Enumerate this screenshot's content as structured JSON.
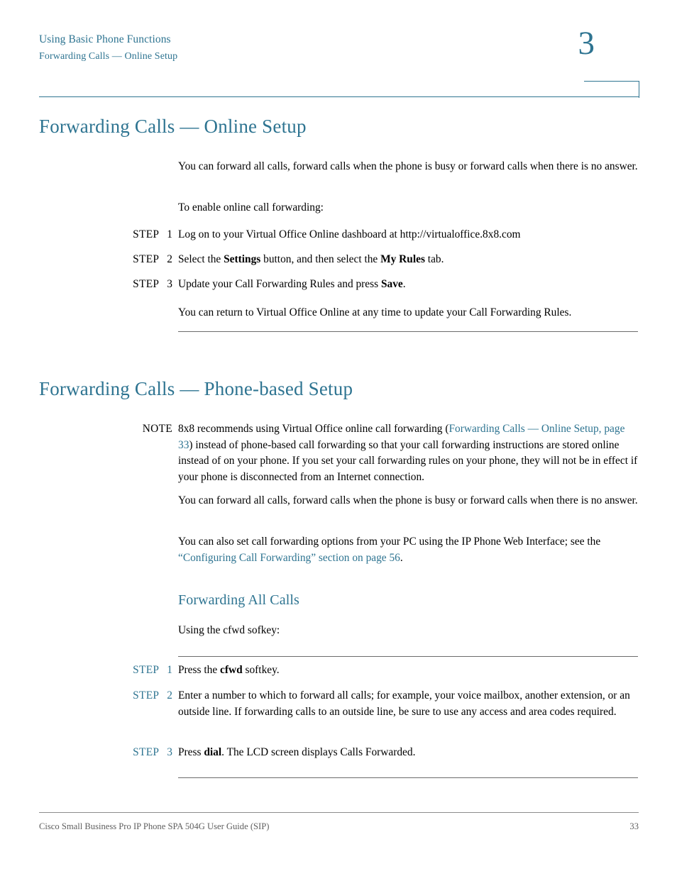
{
  "header": {
    "chapter_title": "Using Basic Phone Functions",
    "section_title": "Forwarding Calls — Online Setup",
    "chapter_number": "3"
  },
  "section_online": {
    "heading": "Forwarding Calls — Online Setup",
    "intro_paragraph": "You can forward all calls, forward calls when the phone is busy or forward calls when there is no answer.",
    "lead_in": "To enable online call forwarding:",
    "steps": [
      {
        "label": "STEP",
        "number": "1",
        "text_before": "Log on to your Virtual Office Online dashboard at http://virtualoffice.8x8.com",
        "bold": "",
        "text_after": ""
      },
      {
        "label": "STEP",
        "number": "2",
        "text_before": "Select the ",
        "bold": "Settings",
        "text_middle": " button, and then select the ",
        "bold2": "My Rules",
        "text_after": " tab."
      },
      {
        "label": "STEP",
        "number": "3",
        "text_before": "Update your Call Forwarding Rules and press ",
        "bold": "Save",
        "text_after": "."
      }
    ],
    "closing_paragraph": "You can return to Virtual Office Online at any time to update your Call Forwarding Rules."
  },
  "section_phone": {
    "heading": "Forwarding Calls — Phone-based Setup",
    "note": {
      "label": "NOTE",
      "text_before": "8x8 recommends using Virtual Office online call forwarding (",
      "link": "Forwarding Calls — Online Setup, page 33",
      "text_after": ") instead of phone-based call forwarding so that your call forwarding instructions are stored online instead of on your phone. If you set your call forwarding rules on your phone, they will not be in effect if your phone is disconnected from an Internet connection."
    },
    "paragraph_1": "You can forward all calls, forward calls when the phone is busy or forward calls when there is no answer.",
    "paragraph_2_before": "You can also set call forwarding options from your PC using the IP Phone Web Interface; see the ",
    "paragraph_2_link": "“Configuring Call Forwarding” section on page 56",
    "paragraph_2_after": ".",
    "subheading": "Forwarding All Calls",
    "subheading_lead_in": "Using the cfwd sofkey:",
    "steps": [
      {
        "label": "STEP",
        "number": "1",
        "text_before": "Press the ",
        "bold": "cfwd",
        "text_after": " softkey."
      },
      {
        "label": "STEP",
        "number": "2",
        "text_before": "Enter a number to which to forward all calls; for example, your voice mailbox, another extension, or an outside line. If forwarding calls to an outside line, be sure to use any access and area codes required.",
        "bold": "",
        "text_after": ""
      },
      {
        "label": "STEP",
        "number": "3",
        "text_before": "Press ",
        "bold": "dial",
        "text_after": ". The LCD screen displays Calls Forwarded."
      }
    ]
  },
  "footer": {
    "document_title": "Cisco Small Business Pro IP Phone SPA 504G User Guide (SIP)",
    "page_number": "33"
  },
  "colors": {
    "accent": "#2e7491",
    "body_text": "#000000",
    "footer_text": "#5f5f5f",
    "rule": "#6c6c6c"
  }
}
